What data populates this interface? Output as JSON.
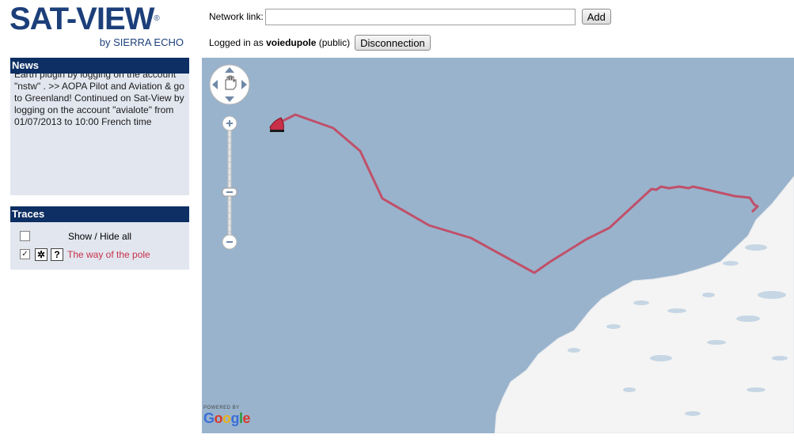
{
  "logo": {
    "main": "SAT-VIEW",
    "reg": "®",
    "sub": "by SIERRA ECHO"
  },
  "toolbar": {
    "network_label": "Network link:",
    "network_value": "",
    "add_label": "Add",
    "logged_prefix": "Logged in as",
    "username": "voiedupole",
    "visibility": "(public)",
    "disconnect_label": "Disconnection"
  },
  "news": {
    "title": "News",
    "text": "Earth plugin by logging on the account \"nstw\" . >> AOPA Pilot and Aviation & go to Greenland! Continued on Sat-View by logging on the account \"avialote\" from 01/07/2013 to 10:00 French time"
  },
  "traces": {
    "title": "Traces",
    "show_hide_label": "Show / Hide all",
    "show_hide_checked": false,
    "items": [
      {
        "name": "The way of the pole",
        "checked": true,
        "color": "#c8304a"
      }
    ]
  },
  "map": {
    "sea_color": "#99b3cc",
    "land_color": "#f4f4f4",
    "track_color": "#c0506a",
    "controls": {
      "pan_icon": "hand-icon",
      "zoom_in_icon": "plus-icon",
      "zoom_out_icon": "minus-icon"
    },
    "attribution_powered": "POWERED BY",
    "attribution_brand": "Google"
  }
}
